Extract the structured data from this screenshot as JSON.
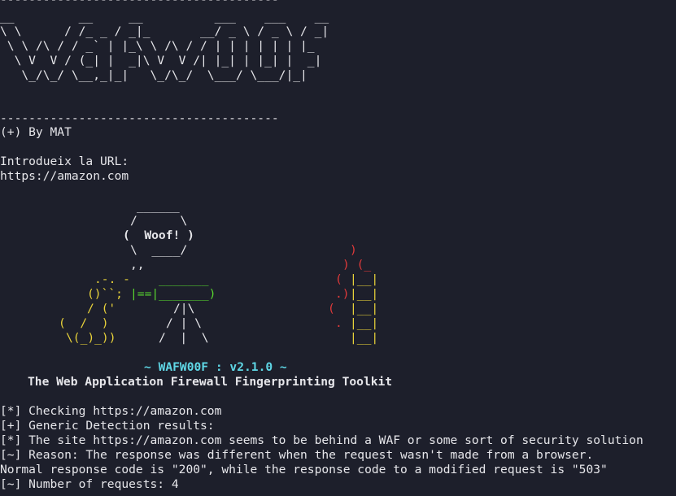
{
  "terminal": {
    "banner": {
      "rule_top": "---------------------------------------",
      "logo": [
        "__         __     __          ___    ___    __",
        "\\ \\      / /_ _ / _|_       __/ _ \\ / _ \\ / _|",
        " \\ \\ /\\ / / _` | |_\\ \\ /\\ / / | | | | | | |_",
        "  \\ V  V / (_| |  _|\\ V  V /| |_| | |_| |  _|",
        "   \\_/\\_/ \\__,_|_|   \\_/\\_/  \\___/ \\___/|_|"
      ],
      "rule_bottom": "---------------------------------------",
      "credit": "(+) By MAT"
    },
    "prompt": {
      "label": "Introdueix la URL:",
      "value": "https://amazon.com"
    },
    "art": {
      "bubble_top": "______",
      "bubble_l1": "/      \\",
      "bubble_l2": "(  Woof! )",
      "bubble_l3": "\\  ____/",
      "bubble_tail": ",,",
      "dog_l1": ".-. -",
      "dog_l2": "()``;",
      "dog_l3": "/ ('",
      "dog_l4": "(  /  )",
      "dog_l5": "\\(_)_))",
      "gun_top": "_______",
      "gun_mid": "|==|_______)",
      "tripod_l1": "/|\\",
      "tripod_l2": "/ | \\",
      "tripod_l3": "/  |  \\",
      "flame_l1": ")",
      "flame_l2": ") (_",
      "flame_l3": "(",
      "flame_l4": ".)",
      "flame_l5": "(",
      "flame_l6": ".",
      "wall_l1": "|__|",
      "wall_l2": "|__|",
      "wall_l3": "|__|",
      "wall_l4": "|__|",
      "wall_l5": "|__|"
    },
    "title": {
      "version_line": "~ WAFW00F : v2.1.0 ~",
      "subtitle": "The Web Application Firewall Fingerprinting Toolkit"
    },
    "output": [
      "[*] Checking https://amazon.com",
      "[+] Generic Detection results:",
      "[*] The site https://amazon.com seems to be behind a WAF or some sort of security solution",
      "[~] Reason: The response was different when the request wasn't made from a browser.",
      "Normal response code is \"200\", while the response code to a modified request is \"503\"",
      "[~] Number of requests: 4"
    ],
    "colors": {
      "background": "#1d1f2b",
      "text": "#e6e6ea",
      "version": "#5fd7e6",
      "flame": "#e03a3a",
      "wall": "#e8d23a",
      "gun": "#57d42f"
    }
  }
}
